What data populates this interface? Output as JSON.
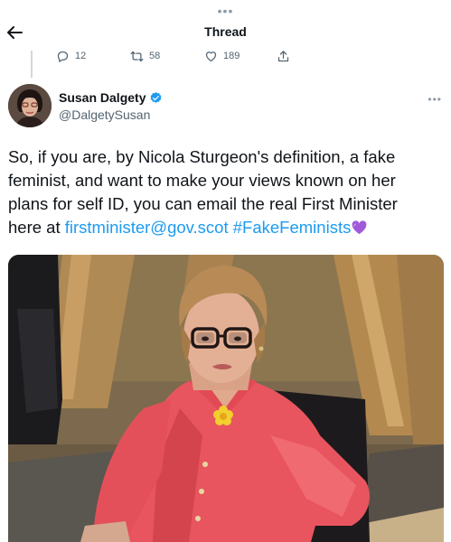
{
  "topbar": {
    "dots": "•••"
  },
  "header": {
    "title": "Thread"
  },
  "prev_tweet": {
    "reply_count": "12",
    "retweet_count": "58",
    "like_count": "189"
  },
  "tweet": {
    "author": {
      "display_name": "Susan Dalgety",
      "handle": "@DalgetySusan",
      "verified": true
    },
    "more": "•••",
    "text_part1": "So, if you are, by Nicola Sturgeon's definition, a fake feminist, and want to make your views known on her plans for self ID, you can email the real First Minister here at ",
    "email_link": "firstminister@gov.scot",
    "hashtag": "#FakeFeminists",
    "emoji": "purple-heart",
    "media_description_icon": "photo"
  },
  "colors": {
    "link": "#1d9bf0",
    "text": "#0f1419",
    "muted": "#536471",
    "verified": "#1d9bf0",
    "jacket": "#e8555e"
  }
}
